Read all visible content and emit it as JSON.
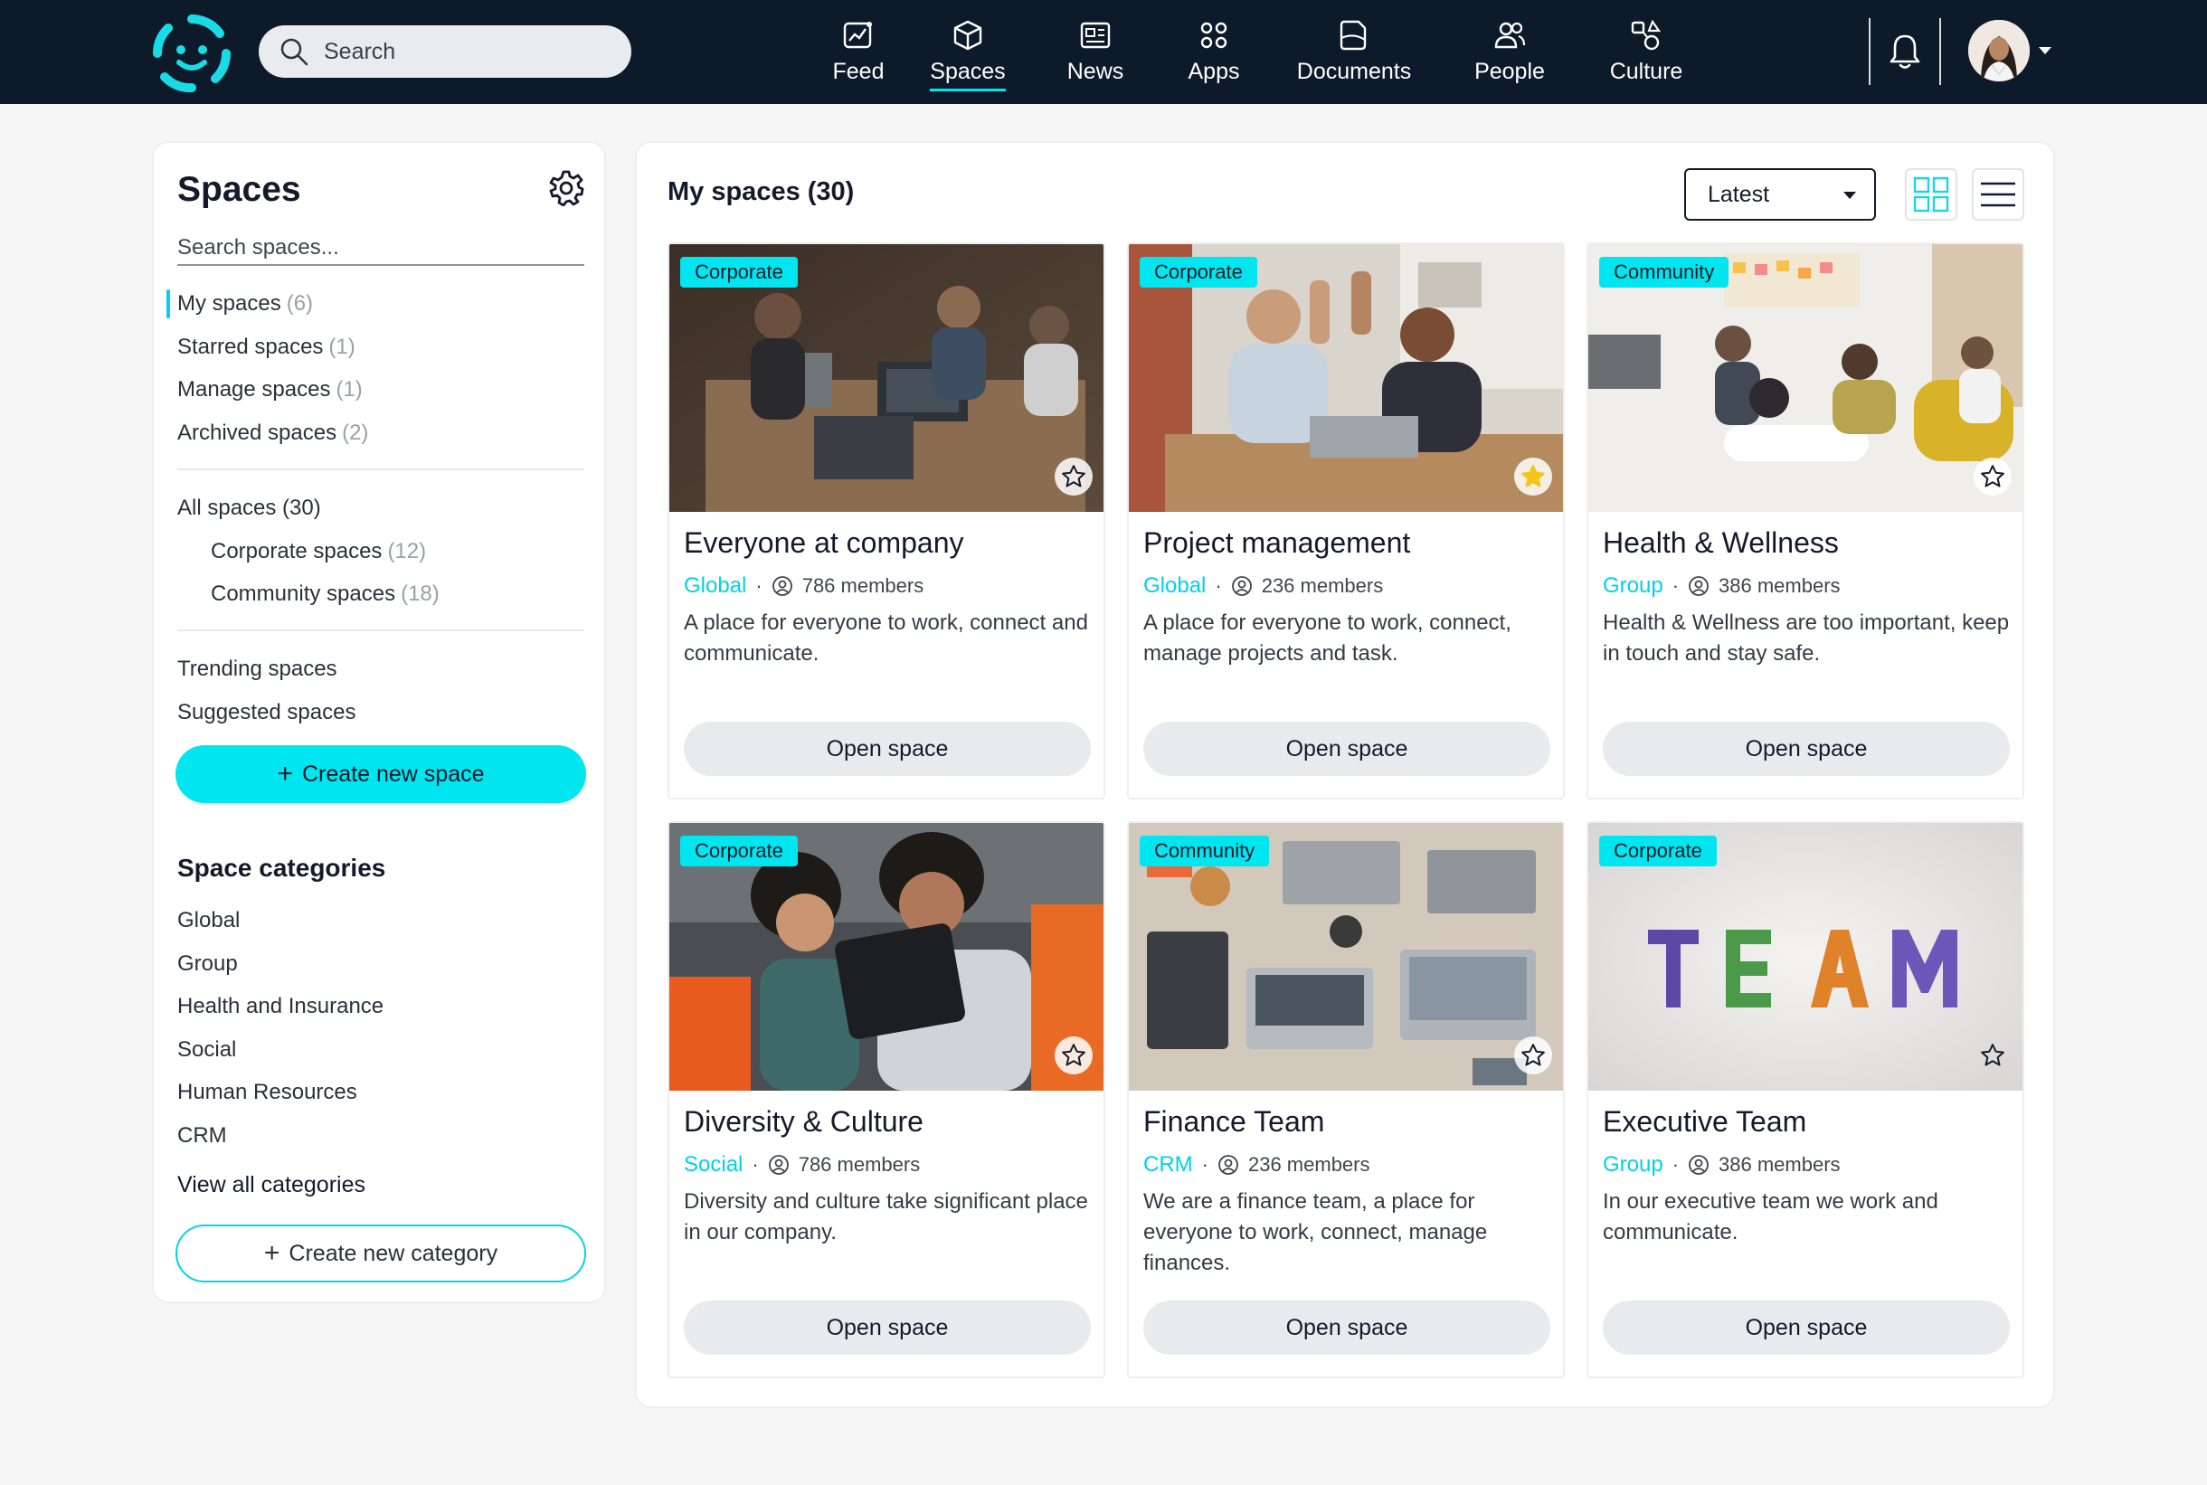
{
  "header": {
    "search_placeholder": "Search",
    "nav": [
      {
        "label": "Feed",
        "icon": "feed-icon"
      },
      {
        "label": "Spaces",
        "icon": "spaces-icon",
        "active": true
      },
      {
        "label": "News",
        "icon": "news-icon"
      },
      {
        "label": "Apps",
        "icon": "apps-icon"
      },
      {
        "label": "Documents",
        "icon": "documents-icon"
      },
      {
        "label": "People",
        "icon": "people-icon"
      },
      {
        "label": "Culture",
        "icon": "culture-icon"
      }
    ]
  },
  "sidebar": {
    "title": "Spaces",
    "search_placeholder": "Search spaces...",
    "group1": [
      {
        "label": "My spaces",
        "count": "(6)",
        "active": true
      },
      {
        "label": "Starred spaces",
        "count": "(1)"
      },
      {
        "label": "Manage spaces",
        "count": "(1)"
      },
      {
        "label": "Archived spaces",
        "count": "(2)"
      }
    ],
    "all_spaces": "All spaces (30)",
    "sub": [
      {
        "label": "Corporate spaces",
        "count": "(12)"
      },
      {
        "label": "Community spaces",
        "count": "(18)"
      }
    ],
    "group3": [
      {
        "label": "Trending spaces"
      },
      {
        "label": "Suggested spaces"
      }
    ],
    "create_space": "Create new space",
    "categories_title": "Space categories",
    "categories": [
      "Global",
      "Group",
      "Health and Insurance",
      "Social",
      "Human Resources",
      "CRM"
    ],
    "view_all": "View all categories",
    "create_category": "Create new category"
  },
  "main": {
    "title": "My spaces (30)",
    "sort_value": "Latest",
    "open_label": "Open space",
    "cards": [
      {
        "tag": "Corporate",
        "title": "Everyone at company",
        "category": "Global",
        "members": "786 members",
        "desc": "A place for everyone to work, connect and communicate.",
        "starred": false
      },
      {
        "tag": "Corporate",
        "title": "Project management",
        "category": "Global",
        "members": "236 members",
        "desc": "A place for everyone to work, connect, manage projects and task.",
        "starred": true
      },
      {
        "tag": "Community",
        "title": "Health & Wellness",
        "category": "Group",
        "members": "386 members",
        "desc": "Health & Wellness are too important, keep in touch and stay safe.",
        "starred": false
      },
      {
        "tag": "Corporate",
        "title": "Diversity & Culture",
        "category": "Social",
        "members": "786 members",
        "desc": "Diversity and culture take significant place in our company.",
        "starred": false
      },
      {
        "tag": "Community",
        "title": "Finance Team",
        "category": "CRM",
        "members": "236 members",
        "desc": "We are a finance team, a place for everyone to work, connect, manage finances.",
        "starred": false
      },
      {
        "tag": "Corporate",
        "title": "Executive Team",
        "category": "Group",
        "members": "386 members",
        "desc": "In our executive team we work and communicate.",
        "starred": false
      }
    ]
  },
  "colors": {
    "accent": "#00e6f0",
    "header_bg": "#0d1a2a",
    "star_filled": "#f5c518"
  }
}
